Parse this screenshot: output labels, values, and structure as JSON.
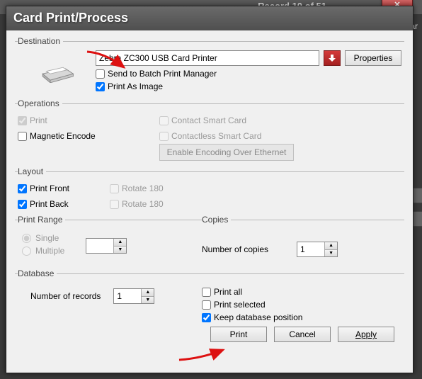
{
  "background": {
    "record_text": "Record 10 of 51",
    "card_label": "Car"
  },
  "window": {
    "title": "Card Print/Process"
  },
  "destination": {
    "legend": "Destination",
    "printer_name": "Zebra ZC300 USB Card Printer",
    "properties_btn": "Properties",
    "send_batch": "Send to Batch Print Manager",
    "print_as_image": "Print As Image"
  },
  "operations": {
    "legend": "Operations",
    "print": "Print",
    "magnetic": "Magnetic Encode",
    "contact": "Contact Smart Card",
    "contactless": "Contactless Smart Card",
    "enable_ethernet": "Enable Encoding Over Ethernet"
  },
  "layout": {
    "legend": "Layout",
    "front": "Print Front",
    "back": "Print Back",
    "rotate": "Rotate 180"
  },
  "range": {
    "legend": "Print Range",
    "single": "Single",
    "multiple": "Multiple",
    "value": ""
  },
  "copies": {
    "legend": "Copies",
    "label": "Number of copies",
    "value": "1"
  },
  "database": {
    "legend": "Database",
    "num_records": "Number of records",
    "value": "1",
    "print_all": "Print all",
    "print_selected": "Print selected",
    "keep_pos": "Keep database position"
  },
  "footer": {
    "print": "Print",
    "cancel": "Cancel",
    "apply": "Apply"
  }
}
